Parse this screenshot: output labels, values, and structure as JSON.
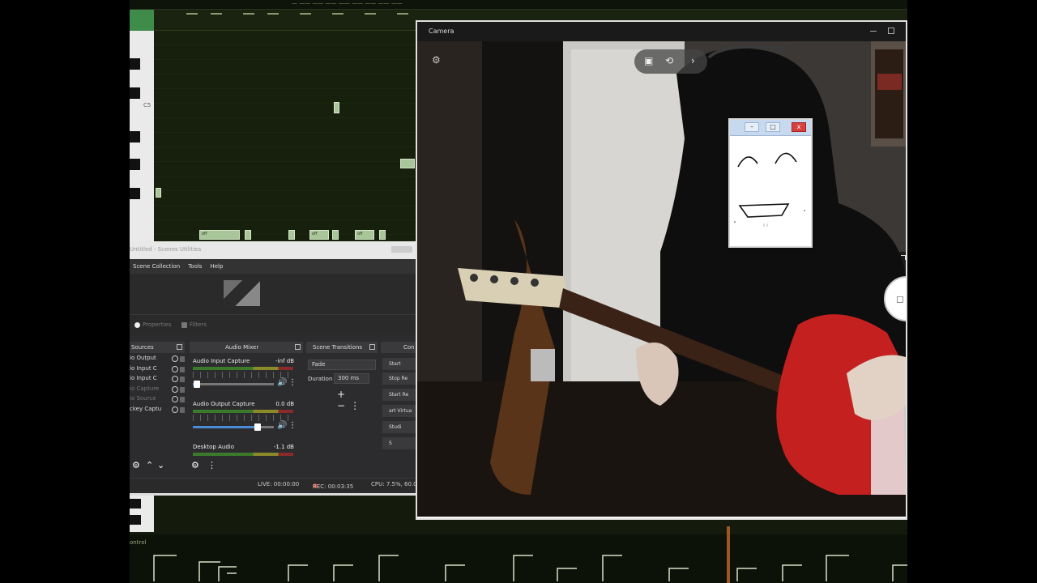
{
  "daw": {
    "topbar_text": "—  ——  ——  ——  ——  ——  ——  ——  ——",
    "note_label": "C5",
    "bottom_label": "ontrol",
    "note_labels": [
      "off",
      "off",
      "off"
    ]
  },
  "obs": {
    "title": "Untitled - Scenes Utilities",
    "menu": [
      "Scene Collection",
      "Tools",
      "Help"
    ],
    "tabs": {
      "properties": "Properties",
      "filters": "Filters"
    },
    "docks": {
      "sources": "Sources",
      "audio_mixer": "Audio Mixer",
      "scene_transitions": "Scene Transitions",
      "controls": "Con"
    },
    "sources": [
      {
        "label": "io Output",
        "dim": false
      },
      {
        "label": "io Input C",
        "dim": false
      },
      {
        "label": "io Input C",
        "dim": false
      },
      {
        "label": "io Capture",
        "dim": true
      },
      {
        "label": "io Source",
        "dim": true
      },
      {
        "label": "ckey Captu",
        "dim": false
      }
    ],
    "mixer": [
      {
        "name": "Audio Input Capture",
        "db": "-inf dB",
        "level": 0.05
      },
      {
        "name": "Audio Output Capture",
        "db": "0.0 dB",
        "level": 0.8
      },
      {
        "name": "Desktop Audio",
        "db": "-1.1 dB",
        "level": 0.75
      }
    ],
    "transition": {
      "type": "Fade",
      "duration_label": "Duration",
      "duration_value": "300 ms",
      "add": "+",
      "remove": "−",
      "more": "⋮"
    },
    "controls": [
      "Start",
      "Stop Re",
      "Start Re",
      "art Virtua",
      "Studi",
      "S"
    ],
    "status": {
      "live": "LIVE: 00:00:00",
      "rec": "REC: 00:03:35",
      "cpu": "CPU: 7.5%, 60.00"
    }
  },
  "camera": {
    "title": "Camera"
  },
  "paint": {
    "close": "x"
  },
  "icons": {
    "settings": "gear-icon",
    "photo_mode": "photo-mode-icon",
    "rotate": "rotate-camera-icon",
    "chevron": "chevron-right-icon",
    "shutter": "camera-shutter-icon",
    "volume": "speaker-icon",
    "more": "more-vertical-icon",
    "lock": "lock-icon",
    "eye": "eye-icon"
  }
}
